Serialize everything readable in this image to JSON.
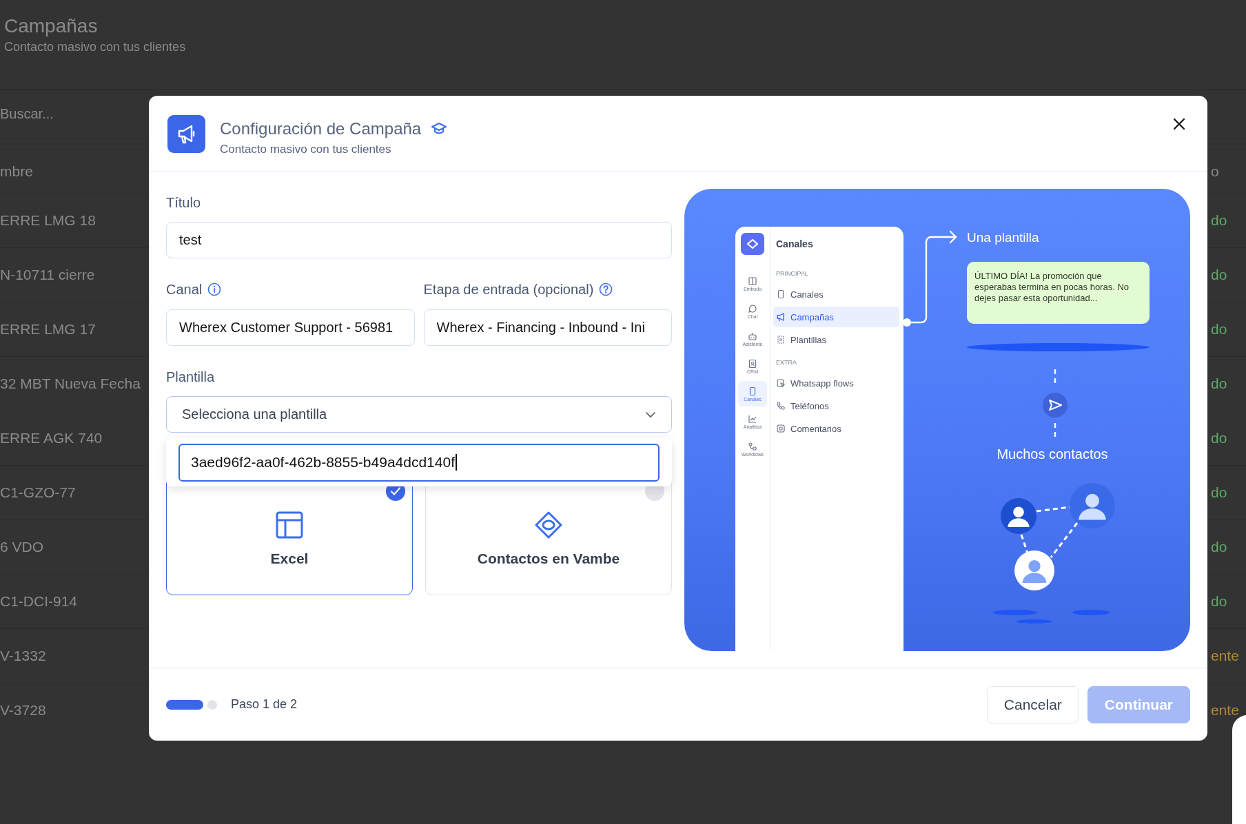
{
  "background_page": {
    "title": "Campañas",
    "subtitle": "Contacto masivo con tus clientes",
    "search": {
      "placeholder": "Buscar..."
    },
    "table": {
      "columns": [
        "mbre",
        "o"
      ],
      "rows": [
        {
          "name": "ERRE LMG 18",
          "status": "do",
          "color": "#5fa86a"
        },
        {
          "name": "N-10711 cierre",
          "status": "do",
          "color": "#5fa86a"
        },
        {
          "name": "ERRE LMG 17",
          "status": "do",
          "color": "#5fa86a"
        },
        {
          "name": "32 MBT Nueva Fecha",
          "status": "do",
          "color": "#5fa86a"
        },
        {
          "name": "ERRE AGK 740",
          "status": "do",
          "color": "#5fa86a"
        },
        {
          "name": "C1-GZO-77",
          "status": "do",
          "color": "#5fa86a"
        },
        {
          "name": "6 VDO",
          "status": "do",
          "color": "#5fa86a"
        },
        {
          "name": "C1-DCI-914",
          "status": "do",
          "color": "#5fa86a"
        },
        {
          "name": "V-1332",
          "status": "ente",
          "color": "#b08a3a"
        },
        {
          "name": "V-3728",
          "status": "ente",
          "color": "#b08a3a"
        }
      ]
    }
  },
  "dialog": {
    "title": "Configuración de Campaña",
    "subtitle": "Contacto masivo con tus clientes",
    "title_field": {
      "label": "Título",
      "value": "test"
    },
    "channel_field": {
      "label": "Canal",
      "value": "Wherex Customer Support - 56981"
    },
    "stage_field": {
      "label": "Etapa de entrada (opcional)",
      "value": "Wherex - Financing - Inbound - Ini"
    },
    "template_field": {
      "label": "Plantilla",
      "placeholder": "Selecciona una plantilla",
      "expanded": true,
      "search_value": "3aed96f2-aa0f-462b-8855-b49a4dcd140f"
    },
    "sources": [
      {
        "label": "Excel",
        "kind": "excel",
        "selected": true
      },
      {
        "label": "Contactos en Vambe",
        "kind": "vambe",
        "selected": false
      }
    ],
    "illustration": {
      "app": {
        "title": "Canales",
        "rail": [
          {
            "label": "Embudo",
            "kind": "funnel",
            "selected": false
          },
          {
            "label": "Chat",
            "kind": "chat",
            "selected": false
          },
          {
            "label": "Asistente",
            "kind": "bot",
            "selected": false
          },
          {
            "label": "CRM",
            "kind": "crm",
            "selected": false
          },
          {
            "label": "Canales",
            "kind": "phone",
            "selected": true
          },
          {
            "label": "Analitica",
            "kind": "chart",
            "selected": false
          },
          {
            "label": "Workflows",
            "kind": "flow",
            "selected": false
          }
        ],
        "sections": [
          {
            "heading": "PRINCIPAL",
            "items": [
              {
                "label": "Canales",
                "kind": "phone",
                "selected": false
              },
              {
                "label": "Campañas",
                "kind": "megaphone",
                "selected": true
              },
              {
                "label": "Plantillas",
                "kind": "template",
                "selected": false
              }
            ]
          },
          {
            "heading": "EXTRA",
            "items": [
              {
                "label": "Whatsapp flows",
                "kind": "flowdoc",
                "selected": false
              },
              {
                "label": "Teléfonos",
                "kind": "call",
                "selected": false
              },
              {
                "label": "Comentarios",
                "kind": "comment",
                "selected": false
              }
            ]
          }
        ]
      },
      "template_caption": "Una plantilla",
      "message": "ÚLTIMO DÍA! La promoción que esperabas termina en pocas horas. No dejes pasar esta oportunidad...",
      "contacts_caption": "Muchos contactos"
    },
    "footer": {
      "steps": [
        {
          "selected": true
        },
        {
          "selected": false
        }
      ],
      "step_text": "Paso 1 de 2",
      "buttons": [
        {
          "label": "Cancelar",
          "kind": "secondary",
          "disabled": false
        },
        {
          "label": "Continuar",
          "kind": "primary",
          "disabled": true
        }
      ]
    }
  }
}
